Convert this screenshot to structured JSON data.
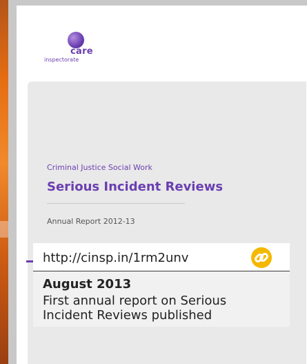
{
  "logo": {
    "care": "care",
    "inspectorate": "inspectorate"
  },
  "cover": {
    "subtitle": "Criminal Justice Social Work",
    "title": "Serious Incident Reviews",
    "report": "Annual Report 2012-13"
  },
  "info": {
    "url": "http://cinsp.in/1rm2unv",
    "link_icon": "link-icon",
    "date": "August 2013",
    "description": "First annual report on Serious Incident Reviews published"
  },
  "colors": {
    "brand_purple": "#6a3fb1",
    "link_yellow": "#f5b800",
    "orange_strip": "#e66d12"
  }
}
